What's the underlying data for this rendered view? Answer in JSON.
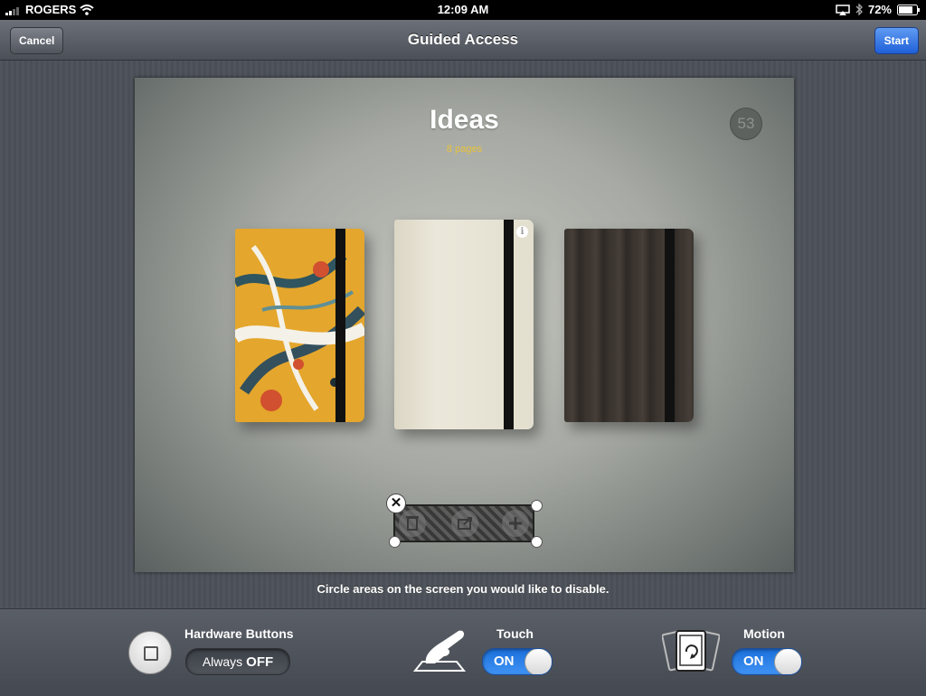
{
  "status": {
    "carrier": "ROGERS",
    "time": "12:09 AM",
    "battery": "72%"
  },
  "nav": {
    "title": "Guided Access",
    "cancel_label": "Cancel",
    "start_label": "Start"
  },
  "app": {
    "title": "Ideas",
    "subtitle": "8 pages",
    "badge_count": "53",
    "info_glyph": "i"
  },
  "selection": {
    "close_glyph": "✕",
    "tools": [
      "trash-icon",
      "share-icon",
      "add-icon"
    ]
  },
  "instruction": "Circle areas on the screen you would like to disable.",
  "options": {
    "hardware": {
      "label": "Hardware Buttons",
      "prefix": "Always",
      "value": "OFF"
    },
    "touch": {
      "label": "Touch",
      "value": "ON"
    },
    "motion": {
      "label": "Motion",
      "value": "ON"
    }
  },
  "colors": {
    "accent_blue": "#1f5fd8",
    "subtitle_yellow": "#e8c23a",
    "switch_blue": "#2a80ea"
  }
}
